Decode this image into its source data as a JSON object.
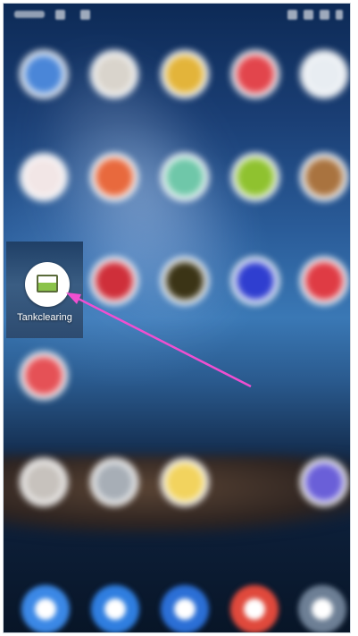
{
  "colors": {
    "accent_arrow": "#f04fd0",
    "tank_fill": "#8bc34a"
  },
  "statusbar": {
    "time": ""
  },
  "highlighted_app": {
    "label": "Tankclearing",
    "icon": "tank-gauge-icon"
  },
  "apps": [
    {
      "id": "r1c1",
      "icon": "google-icon",
      "color": "#4a86d8",
      "label": ""
    },
    {
      "id": "r1c2",
      "icon": "camera-icon",
      "color": "#d9d4cc",
      "label": ""
    },
    {
      "id": "r1c3",
      "icon": "photos-icon",
      "color": "#e3b43a",
      "label": ""
    },
    {
      "id": "r1c4",
      "icon": "red-app-icon",
      "color": "#e2454c",
      "label": ""
    },
    {
      "id": "r1c5",
      "icon": "white-app-icon",
      "color": "#e8edf2",
      "label": ""
    },
    {
      "id": "r2c1",
      "icon": "heart-app-icon",
      "color": "#f2e6e6",
      "label": ""
    },
    {
      "id": "r2c2",
      "icon": "orange-app-icon",
      "color": "#e8693d",
      "label": ""
    },
    {
      "id": "r2c3",
      "icon": "teal-app-icon",
      "color": "#6fc7a9",
      "label": ""
    },
    {
      "id": "r2c4",
      "icon": "green-app-icon",
      "color": "#8fc22f",
      "label": ""
    },
    {
      "id": "r2c5",
      "icon": "folder-icon",
      "color": "#a9733f",
      "label": ""
    },
    {
      "id": "r3c2",
      "icon": "red-app-icon",
      "color": "#cf2f3a",
      "label": ""
    },
    {
      "id": "r3c3",
      "icon": "dark-app-icon",
      "color": "#3b3416",
      "label": ""
    },
    {
      "id": "r3c4",
      "icon": "blue-app-icon",
      "color": "#2f3ed0",
      "label": ""
    },
    {
      "id": "r3c5",
      "icon": "red-app-icon",
      "color": "#df3b44",
      "label": ""
    },
    {
      "id": "r4c1",
      "icon": "red-app-icon",
      "color": "#e55156",
      "label": ""
    },
    {
      "id": "r5c1",
      "icon": "folder-icon",
      "color": "#c7c2bd",
      "label": ""
    },
    {
      "id": "r5c2",
      "icon": "folder-icon",
      "color": "#a7aeb6",
      "label": ""
    },
    {
      "id": "r5c3",
      "icon": "yellow-app-icon",
      "color": "#f2d35e",
      "label": ""
    },
    {
      "id": "r5c5",
      "icon": "purple-app-icon",
      "color": "#6a5fd8",
      "label": ""
    }
  ],
  "dock": [
    {
      "icon": "phone-icon",
      "color": "#3b88e6"
    },
    {
      "icon": "messages-icon",
      "color": "#2f7ee0"
    },
    {
      "icon": "contacts-icon",
      "color": "#2b6fd6"
    },
    {
      "icon": "chrome-icon",
      "color": "#e0493c"
    },
    {
      "icon": "camera-icon",
      "color": "#6d7f95"
    }
  ]
}
